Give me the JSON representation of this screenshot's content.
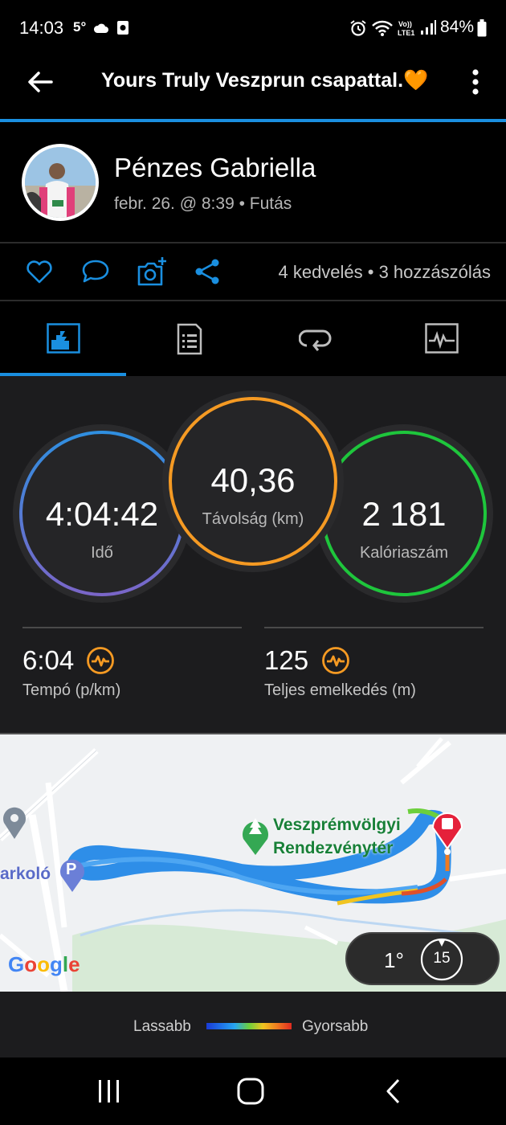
{
  "status_bar": {
    "time": "14:03",
    "temperature": "5°",
    "battery": "84%",
    "icons": [
      "cloud-icon",
      "app-notification-icon",
      "alarm-icon",
      "wifi-icon",
      "volte-icon",
      "signal-icon",
      "battery-icon"
    ]
  },
  "app_bar": {
    "title": "Yours Truly Veszprun csapattal.🧡",
    "back_icon": "arrow-left-icon",
    "menu_icon": "more-vertical-icon"
  },
  "profile": {
    "name": "Pénzes Gabriella",
    "meta": "febr. 26. @ 8:39 • Futás"
  },
  "actions": {
    "icons": [
      "heart-icon",
      "comment-icon",
      "add-photo-icon",
      "share-icon"
    ],
    "counts": "4 kedvelés • 3 hozzászólás"
  },
  "tabs": [
    {
      "name": "overview",
      "icon": "stats-icon",
      "active": true
    },
    {
      "name": "details",
      "icon": "list-document-icon",
      "active": false
    },
    {
      "name": "laps",
      "icon": "loop-icon",
      "active": false
    },
    {
      "name": "charts",
      "icon": "chart-icon",
      "active": false
    }
  ],
  "stats": {
    "time": {
      "value": "4:04:42",
      "label": "Idő"
    },
    "distance": {
      "value": "40,36",
      "label": "Távolság (km)"
    },
    "calories": {
      "value": "2 181",
      "label": "Kalóriaszám"
    },
    "pace": {
      "value": "6:04",
      "label": "Tempó (p/km)"
    },
    "elevation": {
      "value": "125",
      "label": "Teljes emelkedés (m)"
    },
    "colors": {
      "time_ring": "#2f8fe0",
      "distance_ring": "#f59a23",
      "calories_ring": "#1ec63c",
      "metric_icon": "#f59a23"
    }
  },
  "map": {
    "poi_label_line1": "Veszprémvölgyi",
    "poi_label_line2": "Rendezvénytér",
    "parking_label": "arkoló",
    "parking_letter": "P",
    "google_logo": "Google",
    "weather_temp": "1°",
    "wind_speed": "15",
    "route_color": "#2e8ee8"
  },
  "legend": {
    "slow": "Lassabb",
    "fast": "Gyorsabb"
  },
  "navbar": {
    "icons": [
      "recent-apps-icon",
      "home-icon",
      "back-icon"
    ]
  }
}
